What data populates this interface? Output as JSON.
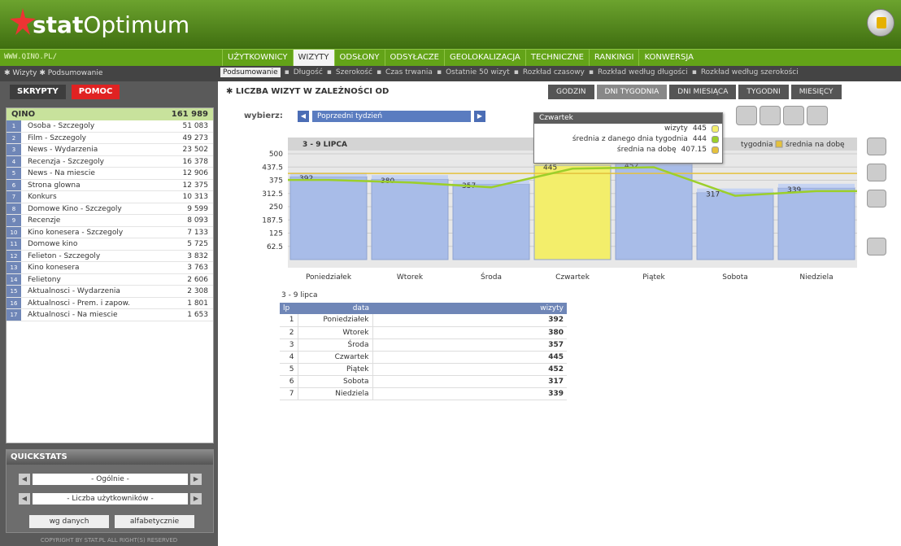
{
  "app": {
    "title_bold": "stat",
    "title_rest": "Optimum",
    "url": "WWW.QINO.PL/"
  },
  "main_nav": [
    "UŻYTKOWNICY",
    "WIZYTY",
    "ODSŁONY",
    "ODSYŁACZE",
    "GEOLOKALIZACJA",
    "TECHNICZNE",
    "RANKINGI",
    "KONWERSJA"
  ],
  "breadcrumb": "✱ Wizyty ✱ Podsumowanie",
  "sub_nav": [
    "Podsumowanie",
    "Długość",
    "Szerokość",
    "Czas trwania",
    "Ostatnie 50 wizyt",
    "Rozkład czasowy",
    "Rozkład według długości",
    "Rozkład według szerokości"
  ],
  "sidebar": {
    "tab_scripts": "SKRYPTY",
    "tab_help": "POMOC",
    "list_title": "QINO",
    "list_total": "161 989",
    "items": [
      {
        "n": "1",
        "t": "Osoba - Szczegoly",
        "v": "51 083"
      },
      {
        "n": "2",
        "t": "Film - Szczegoly",
        "v": "49 273"
      },
      {
        "n": "3",
        "t": "News - Wydarzenia",
        "v": "23 502"
      },
      {
        "n": "4",
        "t": "Recenzja - Szczegoly",
        "v": "16 378"
      },
      {
        "n": "5",
        "t": "News - Na miescie",
        "v": "12 906"
      },
      {
        "n": "6",
        "t": "Strona glowna",
        "v": "12 375"
      },
      {
        "n": "7",
        "t": "Konkurs",
        "v": "10 313"
      },
      {
        "n": "8",
        "t": "Domowe Kino - Szczegoly",
        "v": "9 599"
      },
      {
        "n": "9",
        "t": "Recenzje",
        "v": "8 093"
      },
      {
        "n": "10",
        "t": "Kino konesera - Szczegoly",
        "v": "7 133"
      },
      {
        "n": "11",
        "t": "Domowe kino",
        "v": "5 725"
      },
      {
        "n": "12",
        "t": "Felieton - Szczegoly",
        "v": "3 832"
      },
      {
        "n": "13",
        "t": "Kino konesera",
        "v": "3 763"
      },
      {
        "n": "14",
        "t": "Felietony",
        "v": "2 606"
      },
      {
        "n": "15",
        "t": "Aktualnosci - Wydarzenia",
        "v": "2 308"
      },
      {
        "n": "16",
        "t": "Aktualnosci - Prem. i zapow.",
        "v": "1 801"
      },
      {
        "n": "17",
        "t": "Aktualnosci - Na miescie",
        "v": "1 653"
      }
    ],
    "quickstats": {
      "title": "QUICKSTATS",
      "sel1": "- Ogólnie -",
      "sel2": "- Liczba użytkowników -",
      "btn1": "wg danych",
      "btn2": "alfabetycznie"
    },
    "copyright": "COPYRIGHT BY STAT.PL ALL RIGHT(S) RESERVED"
  },
  "content": {
    "title": "✱ LICZBA WIZYT W ZALEŻNOŚCI OD",
    "view_tabs": [
      "GODZIN",
      "DNI TYGODNIA",
      "DNI MIESIĄCA",
      "TYGODNI",
      "MIESIĘCY"
    ],
    "choose_label": "wybierz:",
    "period": "Poprzedni tydzień",
    "tooltip": {
      "title": "Czwartek",
      "r1": "wizyty",
      "v1": "445",
      "r2": "średnia z danego dnia tygodnia",
      "v2": "444",
      "r3": "średnia na dobę",
      "v3": "407.15"
    },
    "legend_partial": "tygodnia",
    "legend_avg": "średnia na dobę",
    "table_label": "3 - 9 lipca",
    "table_headers": [
      "lp",
      "data",
      "wizyty"
    ],
    "table_rows": [
      [
        "1",
        "Poniedziałek",
        "392"
      ],
      [
        "2",
        "Wtorek",
        "380"
      ],
      [
        "3",
        "Środa",
        "357"
      ],
      [
        "4",
        "Czwartek",
        "445"
      ],
      [
        "5",
        "Piątek",
        "452"
      ],
      [
        "6",
        "Sobota",
        "317"
      ],
      [
        "7",
        "Niedziela",
        "339"
      ]
    ]
  },
  "chart_data": {
    "type": "bar",
    "title": "3 - 9 LIPCA",
    "categories": [
      "Poniedziałek",
      "Wtorek",
      "Środa",
      "Czwartek",
      "Piątek",
      "Sobota",
      "Niedziela"
    ],
    "values": [
      392,
      380,
      357,
      445,
      452,
      317,
      339
    ],
    "highlight_index": 3,
    "average_per_day": 407.15,
    "yticks": [
      "500",
      "437.5",
      "375",
      "312.5",
      "250",
      "187.5",
      "125",
      "62.5"
    ],
    "ylim": [
      0,
      500
    ],
    "colors": {
      "bar": "#a8bce8",
      "highlight": "#f3ee6b",
      "line": "#9ccf2a",
      "avg": "#e5c13c"
    }
  }
}
